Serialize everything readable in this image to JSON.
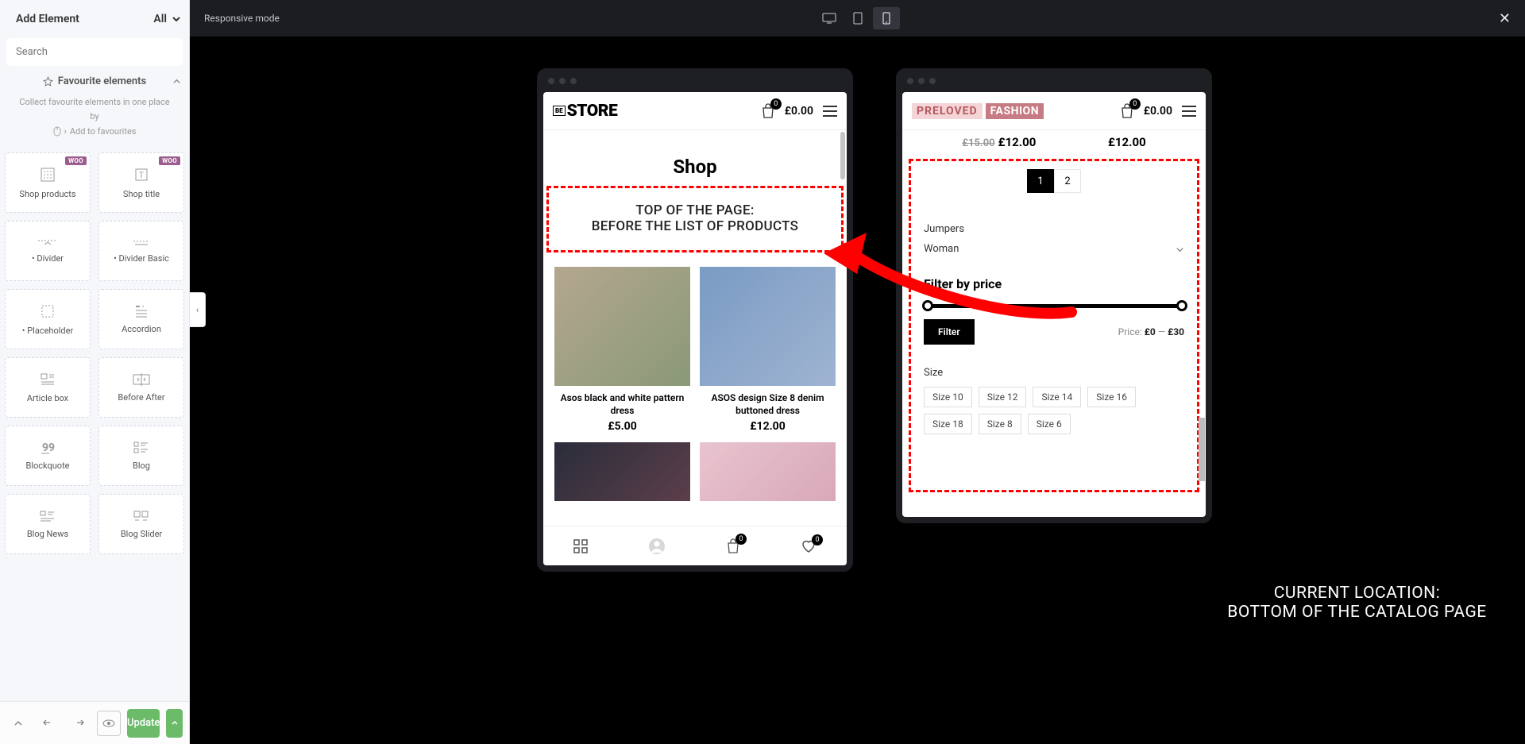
{
  "sidebar": {
    "title": "Add Element",
    "filter": "All",
    "search_placeholder": "Search",
    "fav_title": "Favourite elements",
    "fav_desc": "Collect favourite elements in one place by",
    "fav_link": "Add to favourites",
    "elements": [
      {
        "label": "Shop products",
        "woo": true
      },
      {
        "label": "Shop title",
        "woo": true
      },
      {
        "label": "• Divider"
      },
      {
        "label": "• Divider Basic"
      },
      {
        "label": "• Placeholder"
      },
      {
        "label": "Accordion"
      },
      {
        "label": "Article box"
      },
      {
        "label": "Before After"
      },
      {
        "label": "Blockquote"
      },
      {
        "label": "Blog"
      },
      {
        "label": "Blog News"
      },
      {
        "label": "Blog Slider"
      }
    ],
    "update_label": "Update"
  },
  "topbar": {
    "mode": "Responsive mode"
  },
  "phone1": {
    "logo_be": "BE",
    "logo_main": "STORE",
    "cart_count": "0",
    "cart_total": "£0.00",
    "shop_title": "Shop",
    "note_l1": "TOP OF THE PAGE:",
    "note_l2": "BEFORE THE LIST OF PRODUCTS",
    "products": [
      {
        "name": "Asos black and white pattern dress",
        "price": "£5.00"
      },
      {
        "name": "ASOS design Size 8 denim buttoned dress",
        "price": "£12.00"
      }
    ],
    "foot_cart_count": "0",
    "foot_heart_count": "0"
  },
  "phone2": {
    "logo_a": "PRELOVED",
    "logo_b": "FASHION",
    "cart_count": "0",
    "cart_total": "£0.00",
    "old_price": "£15.00",
    "new_price": "£12.00",
    "price2": "£12.00",
    "page1": "1",
    "page2": "2",
    "cat1": "Jumpers",
    "cat2": "Woman",
    "filter_title": "Filter by price",
    "filter_btn": "Filter",
    "price_lbl": "Price:",
    "price_min": "£0",
    "price_dash": "—",
    "price_max": "£30",
    "size_lbl": "Size",
    "sizes": [
      "Size 10",
      "Size 12",
      "Size 14",
      "Size 16",
      "Size 18",
      "Size 8",
      "Size 6"
    ]
  },
  "black_label": {
    "l1": "CURRENT LOCATION:",
    "l2": "BOTTOM OF THE CATALOG PAGE"
  }
}
